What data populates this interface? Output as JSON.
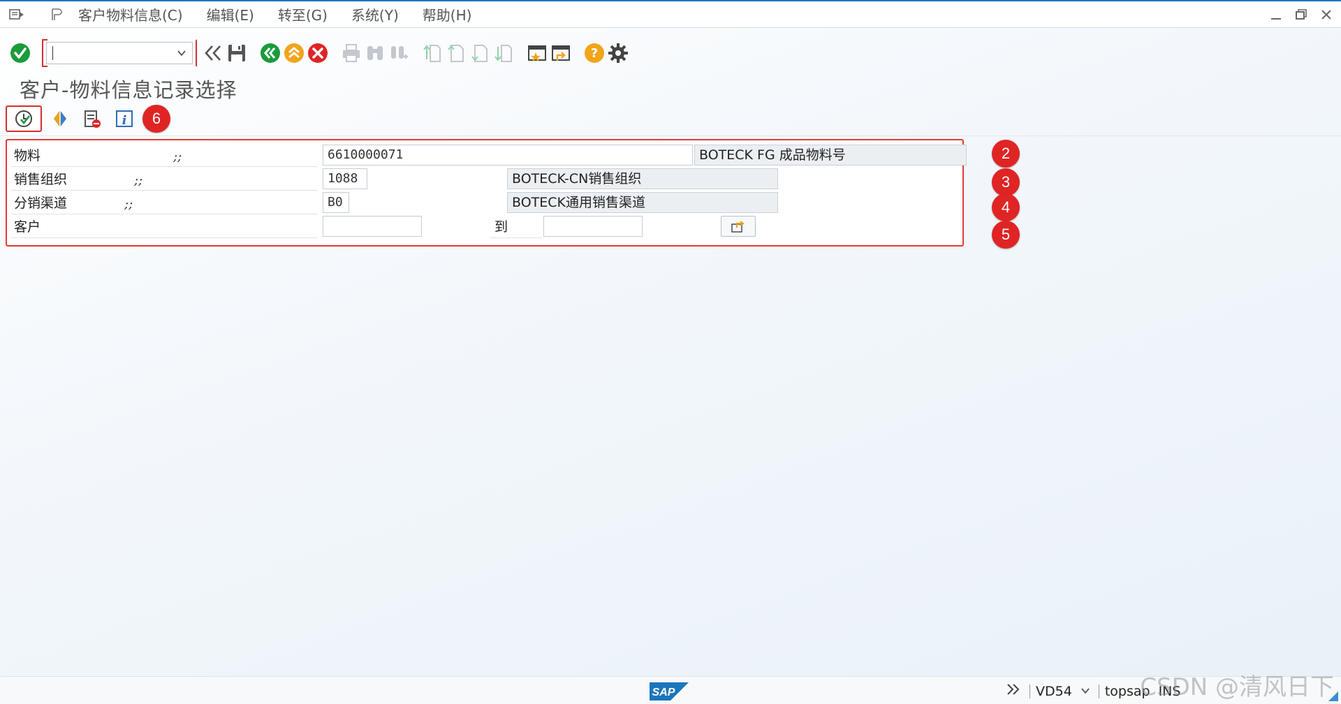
{
  "menubar": {
    "items": [
      "客户物料信息(C)",
      "编辑(E)",
      "转至(G)",
      "系统(Y)",
      "帮助(H)"
    ]
  },
  "toolbar": {
    "command_value": "",
    "icons": [
      "enter-icon",
      "command-field",
      "collapse-icon",
      "save-icon",
      "back-icon",
      "exit-icon",
      "cancel-icon",
      "print-icon",
      "find-icon",
      "find-next-icon",
      "first-page-icon",
      "previous-page-icon",
      "next-page-icon",
      "last-page-icon",
      "create-session-icon",
      "shortcut-icon",
      "help-icon",
      "settings-icon"
    ]
  },
  "page": {
    "title": "客户-物料信息记录选择"
  },
  "app_toolbar": {
    "badge": "6"
  },
  "form": {
    "material": {
      "label": "物料",
      "req": ";;",
      "value": "6610000071",
      "desc": "BOTECK FG 成品物料号",
      "badge": "2"
    },
    "sales_org": {
      "label": "销售组织",
      "req": ";;",
      "value": "1088",
      "desc": "BOTECK-CN销售组织",
      "badge": "3"
    },
    "dist_channel": {
      "label": "分销渠道",
      "req": ";;",
      "value": "B0",
      "desc": "BOTECK通用销售渠道",
      "badge": "4"
    },
    "customer": {
      "label": "客户",
      "from": "",
      "to_label": "到",
      "to": "",
      "badge": "5"
    }
  },
  "statusbar": {
    "logo": "SAP",
    "transaction": "VD54",
    "server": "topsap",
    "mode": "INS",
    "watermark": "CSDN @清风日下"
  },
  "colors": {
    "accent": "#1e73be",
    "highlight": "#e53935",
    "badge": "#e02424"
  }
}
